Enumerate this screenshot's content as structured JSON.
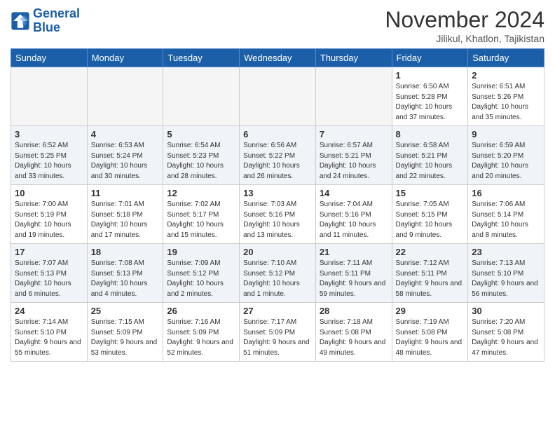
{
  "header": {
    "logo_line1": "General",
    "logo_line2": "Blue",
    "month_title": "November 2024",
    "location": "Jilikul, Khatlon, Tajikistan"
  },
  "weekdays": [
    "Sunday",
    "Monday",
    "Tuesday",
    "Wednesday",
    "Thursday",
    "Friday",
    "Saturday"
  ],
  "weeks": [
    [
      {
        "day": "",
        "info": ""
      },
      {
        "day": "",
        "info": ""
      },
      {
        "day": "",
        "info": ""
      },
      {
        "day": "",
        "info": ""
      },
      {
        "day": "",
        "info": ""
      },
      {
        "day": "1",
        "info": "Sunrise: 6:50 AM\nSunset: 5:28 PM\nDaylight: 10 hours and 37 minutes."
      },
      {
        "day": "2",
        "info": "Sunrise: 6:51 AM\nSunset: 5:26 PM\nDaylight: 10 hours and 35 minutes."
      }
    ],
    [
      {
        "day": "3",
        "info": "Sunrise: 6:52 AM\nSunset: 5:25 PM\nDaylight: 10 hours and 33 minutes."
      },
      {
        "day": "4",
        "info": "Sunrise: 6:53 AM\nSunset: 5:24 PM\nDaylight: 10 hours and 30 minutes."
      },
      {
        "day": "5",
        "info": "Sunrise: 6:54 AM\nSunset: 5:23 PM\nDaylight: 10 hours and 28 minutes."
      },
      {
        "day": "6",
        "info": "Sunrise: 6:56 AM\nSunset: 5:22 PM\nDaylight: 10 hours and 26 minutes."
      },
      {
        "day": "7",
        "info": "Sunrise: 6:57 AM\nSunset: 5:21 PM\nDaylight: 10 hours and 24 minutes."
      },
      {
        "day": "8",
        "info": "Sunrise: 6:58 AM\nSunset: 5:21 PM\nDaylight: 10 hours and 22 minutes."
      },
      {
        "day": "9",
        "info": "Sunrise: 6:59 AM\nSunset: 5:20 PM\nDaylight: 10 hours and 20 minutes."
      }
    ],
    [
      {
        "day": "10",
        "info": "Sunrise: 7:00 AM\nSunset: 5:19 PM\nDaylight: 10 hours and 19 minutes."
      },
      {
        "day": "11",
        "info": "Sunrise: 7:01 AM\nSunset: 5:18 PM\nDaylight: 10 hours and 17 minutes."
      },
      {
        "day": "12",
        "info": "Sunrise: 7:02 AM\nSunset: 5:17 PM\nDaylight: 10 hours and 15 minutes."
      },
      {
        "day": "13",
        "info": "Sunrise: 7:03 AM\nSunset: 5:16 PM\nDaylight: 10 hours and 13 minutes."
      },
      {
        "day": "14",
        "info": "Sunrise: 7:04 AM\nSunset: 5:16 PM\nDaylight: 10 hours and 11 minutes."
      },
      {
        "day": "15",
        "info": "Sunrise: 7:05 AM\nSunset: 5:15 PM\nDaylight: 10 hours and 9 minutes."
      },
      {
        "day": "16",
        "info": "Sunrise: 7:06 AM\nSunset: 5:14 PM\nDaylight: 10 hours and 8 minutes."
      }
    ],
    [
      {
        "day": "17",
        "info": "Sunrise: 7:07 AM\nSunset: 5:13 PM\nDaylight: 10 hours and 6 minutes."
      },
      {
        "day": "18",
        "info": "Sunrise: 7:08 AM\nSunset: 5:13 PM\nDaylight: 10 hours and 4 minutes."
      },
      {
        "day": "19",
        "info": "Sunrise: 7:09 AM\nSunset: 5:12 PM\nDaylight: 10 hours and 2 minutes."
      },
      {
        "day": "20",
        "info": "Sunrise: 7:10 AM\nSunset: 5:12 PM\nDaylight: 10 hours and 1 minute."
      },
      {
        "day": "21",
        "info": "Sunrise: 7:11 AM\nSunset: 5:11 PM\nDaylight: 9 hours and 59 minutes."
      },
      {
        "day": "22",
        "info": "Sunrise: 7:12 AM\nSunset: 5:11 PM\nDaylight: 9 hours and 58 minutes."
      },
      {
        "day": "23",
        "info": "Sunrise: 7:13 AM\nSunset: 5:10 PM\nDaylight: 9 hours and 56 minutes."
      }
    ],
    [
      {
        "day": "24",
        "info": "Sunrise: 7:14 AM\nSunset: 5:10 PM\nDaylight: 9 hours and 55 minutes."
      },
      {
        "day": "25",
        "info": "Sunrise: 7:15 AM\nSunset: 5:09 PM\nDaylight: 9 hours and 53 minutes."
      },
      {
        "day": "26",
        "info": "Sunrise: 7:16 AM\nSunset: 5:09 PM\nDaylight: 9 hours and 52 minutes."
      },
      {
        "day": "27",
        "info": "Sunrise: 7:17 AM\nSunset: 5:09 PM\nDaylight: 9 hours and 51 minutes."
      },
      {
        "day": "28",
        "info": "Sunrise: 7:18 AM\nSunset: 5:08 PM\nDaylight: 9 hours and 49 minutes."
      },
      {
        "day": "29",
        "info": "Sunrise: 7:19 AM\nSunset: 5:08 PM\nDaylight: 9 hours and 48 minutes."
      },
      {
        "day": "30",
        "info": "Sunrise: 7:20 AM\nSunset: 5:08 PM\nDaylight: 9 hours and 47 minutes."
      }
    ]
  ]
}
